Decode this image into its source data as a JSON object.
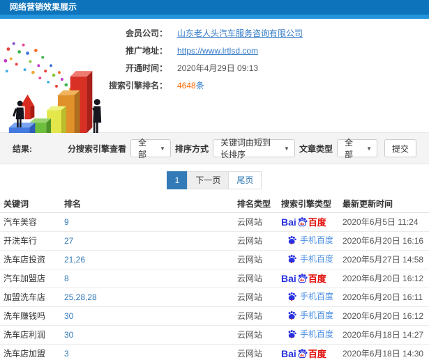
{
  "header": {
    "title": "网络营销效果展示"
  },
  "info": {
    "rows": [
      {
        "label": "会员公司：",
        "value": "山东老人头汽车服务咨询有限公司"
      },
      {
        "label": "推广地址：",
        "value": "https://www.lrtlsd.com"
      },
      {
        "label": "开通时间：",
        "value": "2020年4月29日 09:13"
      },
      {
        "label": "搜索引擎排名：",
        "value": "4648",
        "suffix": "条"
      }
    ]
  },
  "illustration": {
    "name": "3d-bar-chart-growth-illustration"
  },
  "filter": {
    "section_label": "结果:",
    "engine_label": "分搜索引擎查看",
    "engine_value": "全部",
    "sort_label": "排序方式",
    "sort_value": "关键词由短到长排序",
    "type_label": "文章类型",
    "type_value": "全部",
    "submit_label": "提交",
    "dropdown_arrow": "▼"
  },
  "pagination": {
    "items": [
      {
        "label": "1",
        "state": "active"
      },
      {
        "label": "下一页",
        "state": "normal"
      },
      {
        "label": "尾页",
        "state": "link"
      }
    ]
  },
  "baidu_logo": {
    "latin": "Bai",
    "cn": "百度"
  },
  "table": {
    "headers": [
      "关键词",
      "排名",
      "排名类型",
      "搜索引擎类型",
      "最新更新时间"
    ],
    "rows": [
      {
        "keyword": "汽车美容",
        "rank": "9",
        "rank_type": "云网站",
        "engine": "baidu",
        "engine_label": "百度",
        "updated": "2020年6月5日 11:24"
      },
      {
        "keyword": "开洗车行",
        "rank": "27",
        "rank_type": "云网站",
        "engine": "mobile-baidu",
        "engine_label": "手机百度",
        "updated": "2020年6月20日 16:16"
      },
      {
        "keyword": "洗车店投资",
        "rank": "21,26",
        "rank_type": "云网站",
        "engine": "mobile-baidu",
        "engine_label": "手机百度",
        "updated": "2020年5月27日 14:58"
      },
      {
        "keyword": "汽车加盟店",
        "rank": "8",
        "rank_type": "云网站",
        "engine": "baidu",
        "engine_label": "百度",
        "updated": "2020年6月20日 16:12"
      },
      {
        "keyword": "加盟洗车店",
        "rank": "25,28,28",
        "rank_type": "云网站",
        "engine": "mobile-baidu",
        "engine_label": "手机百度",
        "updated": "2020年6月20日 16:11"
      },
      {
        "keyword": "洗车赚钱吗",
        "rank": "30",
        "rank_type": "云网站",
        "engine": "mobile-baidu",
        "engine_label": "手机百度",
        "updated": "2020年6月20日 16:12"
      },
      {
        "keyword": "洗车店利润",
        "rank": "30",
        "rank_type": "云网站",
        "engine": "mobile-baidu",
        "engine_label": "手机百度",
        "updated": "2020年6月18日 14:27"
      },
      {
        "keyword": "洗车店加盟",
        "rank": "3",
        "rank_type": "云网站",
        "engine": "baidu",
        "engine_label": "百度",
        "updated": "2020年6月18日 14:30"
      }
    ]
  },
  "colors": {
    "topbar_blue": "#0d73bb",
    "topbar_blue_light": "#2394dc",
    "link_blue": "#3179c8",
    "rank_blue": "#337ab7",
    "count_orange": "#ff6600",
    "baidu_blue": "#2932e1",
    "baidu_red": "#e10602",
    "mobile_baidu_blue": "#4a8fe2",
    "filterbar_gray": "#f4f4f4"
  }
}
